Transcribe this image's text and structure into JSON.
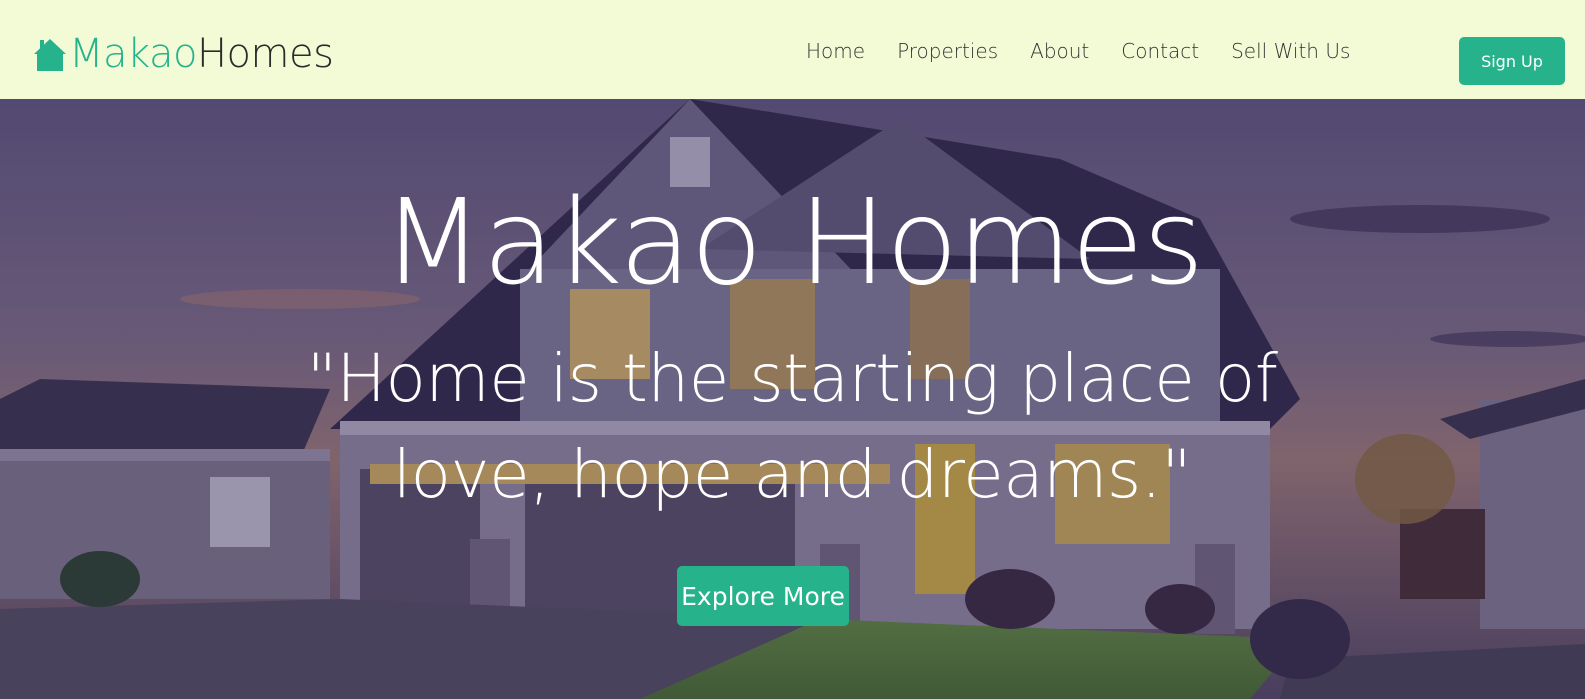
{
  "navbar": {
    "logo": {
      "part1": "Makao",
      "part2": "Homes",
      "icon": "house-icon"
    },
    "links": [
      {
        "label": "Home"
      },
      {
        "label": "Properties"
      },
      {
        "label": "About"
      },
      {
        "label": "Contact"
      },
      {
        "label": "Sell With Us"
      }
    ],
    "signup_label": "Sign Up"
  },
  "hero": {
    "title": "Makao Homes",
    "quote": "\"Home is the starting place of love, hope and dreams.\"",
    "cta_label": "Explore More"
  },
  "colors": {
    "accent": "#26b38b",
    "navbar_bg": "#f2fbd6",
    "text_dark": "#333333"
  }
}
